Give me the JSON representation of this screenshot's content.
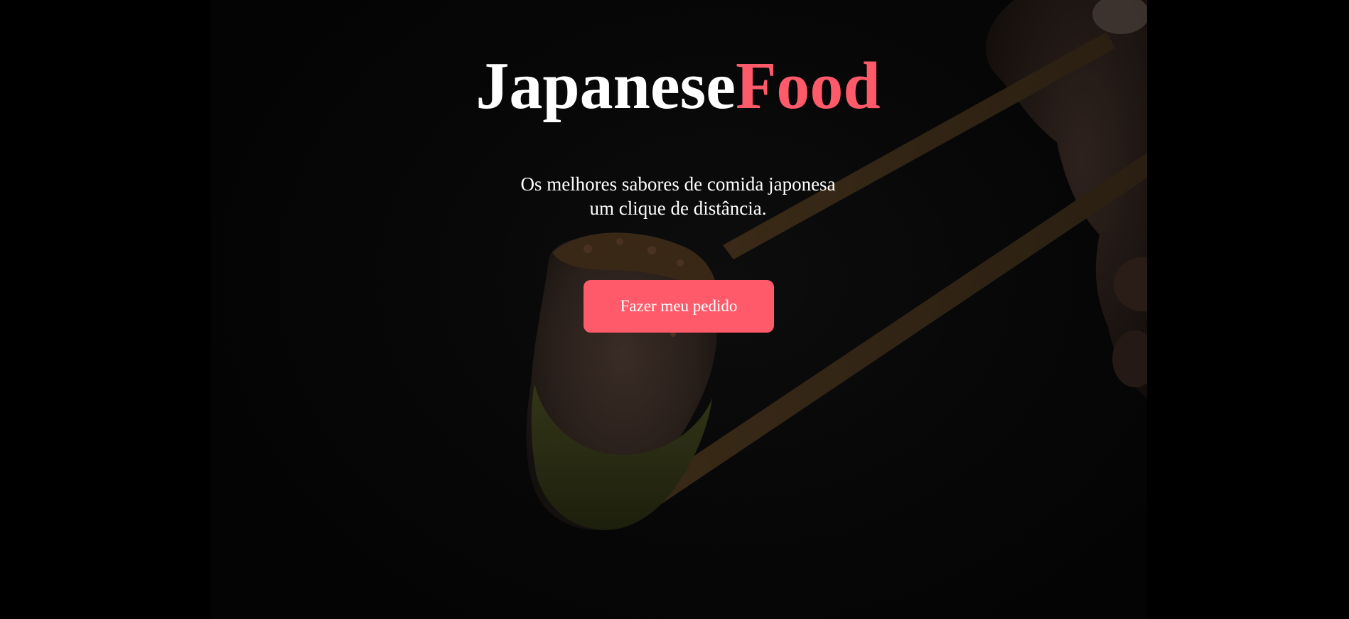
{
  "brand": {
    "part1": "Japanese",
    "part2": "Food",
    "accent_color": "#ff5a6a"
  },
  "tagline": {
    "line1": "Os melhores sabores de comida japonesa",
    "line2": "um clique de distância."
  },
  "cta": {
    "label": "Fazer meu pedido"
  },
  "hero_image": {
    "icon": "sushi-chopsticks-photo"
  }
}
